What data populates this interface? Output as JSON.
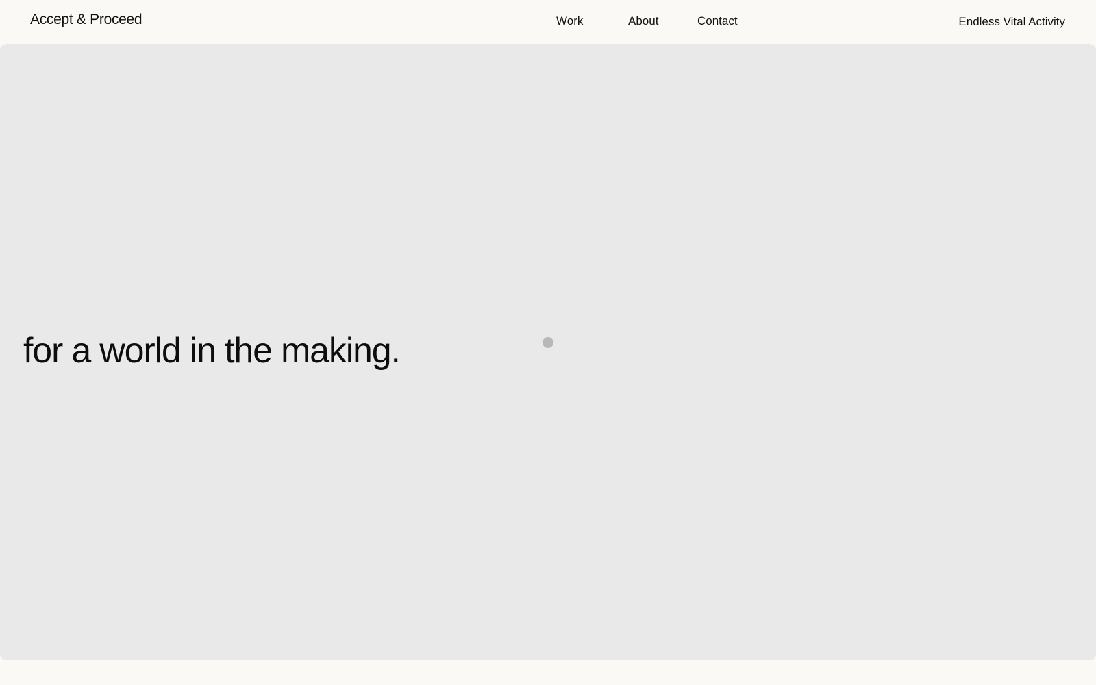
{
  "header": {
    "logo": "Accept & Proceed",
    "nav": {
      "work": "Work",
      "about": "About",
      "contact": "Contact"
    },
    "tagline": "Endless Vital Activity"
  },
  "hero": {
    "headline": "for a world in the making."
  },
  "colors": {
    "page_background": "#faf9f6",
    "hero_background": "#e9e9e9",
    "text": "#111111",
    "cursor_dot": "#b8b8b8"
  }
}
